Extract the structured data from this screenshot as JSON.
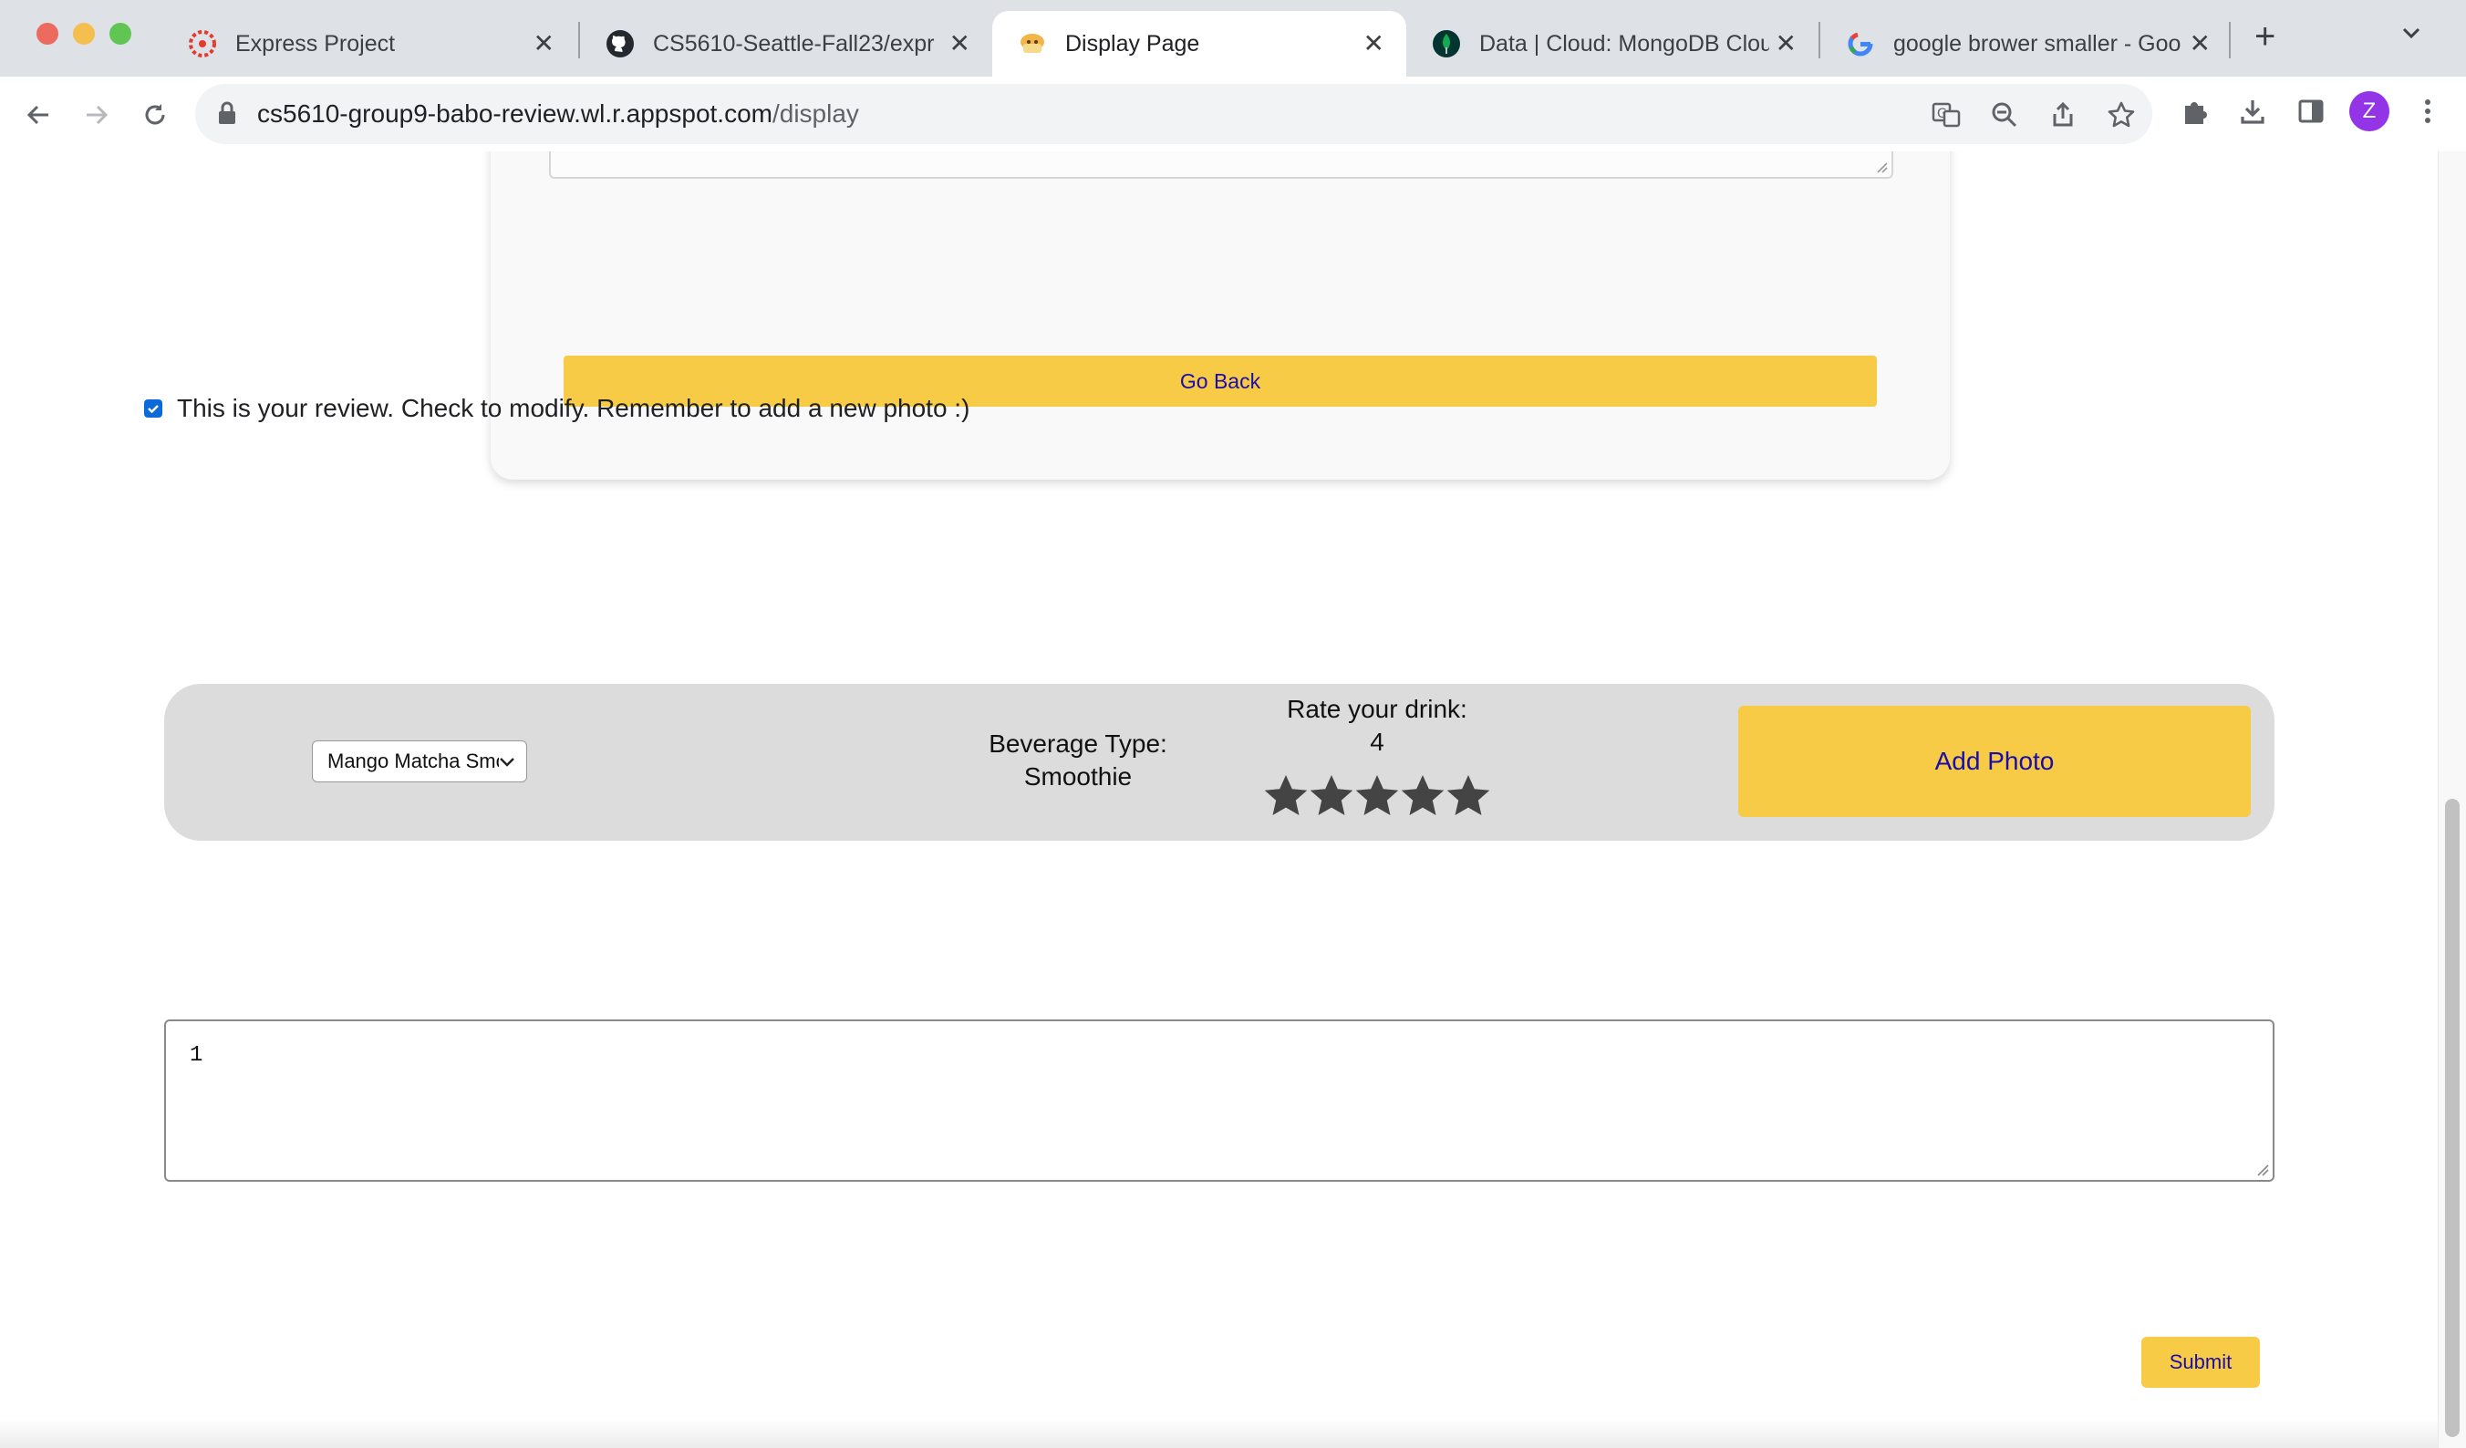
{
  "browser": {
    "tabs": [
      {
        "title": "Express Project",
        "icon": "canvas-logo-icon",
        "active": false
      },
      {
        "title": "CS5610-Seattle-Fall23/expr",
        "icon": "github-icon",
        "active": false
      },
      {
        "title": "Display Page",
        "icon": "bubble-tea-icon",
        "active": true
      },
      {
        "title": "Data | Cloud: MongoDB Clou",
        "icon": "mongodb-leaf-icon",
        "active": false
      },
      {
        "title": "google brower smaller - Goo",
        "icon": "google-g-icon",
        "active": false
      }
    ],
    "url_host": "cs5610-group9-babo-review.wl.r.appspot.com",
    "url_path": "/display",
    "profile_initial": "Z"
  },
  "page": {
    "go_back_label": "Go Back",
    "modify_checkbox_label": "This is your review. Check to modify. Remember to add a new photo :)",
    "modify_checked": true,
    "drink_select_value": "Mango Matcha Smoothie",
    "beverage_type_label": "Beverage Type:",
    "beverage_type_value": "Smoothie",
    "rate_label": "Rate your drink:",
    "rating_value": "4",
    "stars_total": 5,
    "add_photo_label": "Add Photo",
    "comment_value": "1",
    "submit_label": "Submit"
  },
  "colors": {
    "accent_yellow": "#f7cb45",
    "link_blue": "#1a0dab",
    "panel_gray": "#dcdcdc"
  }
}
